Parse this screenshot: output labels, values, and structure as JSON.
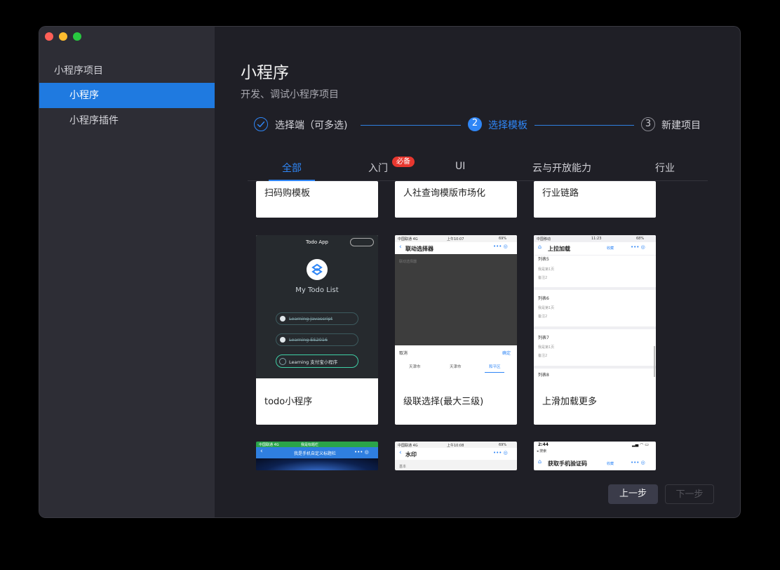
{
  "sidebar": {
    "section_title": "小程序项目",
    "items": [
      {
        "label": "小程序",
        "active": true
      },
      {
        "label": "小程序插件",
        "active": false
      }
    ]
  },
  "main": {
    "title": "小程序",
    "subtitle": "开发、调试小程序项目"
  },
  "steps": [
    {
      "number": "1",
      "label": "选择端（可多选)",
      "state": "done"
    },
    {
      "number": "2",
      "label": "选择模板",
      "state": "current"
    },
    {
      "number": "3",
      "label": "新建项目",
      "state": "pending"
    }
  ],
  "tabs": [
    {
      "label": "全部",
      "active": true
    },
    {
      "label": "入门",
      "badge": "必备"
    },
    {
      "label": "UI"
    },
    {
      "label": "云与开放能力"
    },
    {
      "label": "行业"
    }
  ],
  "cards_row1": [
    "扫码购模板",
    "人社查询模版市场化",
    "行业链路"
  ],
  "cards_row2": [
    {
      "title": "todo小程序",
      "thumb": {
        "header": "Todo App",
        "heading": "My Todo List",
        "items": [
          "Learning Javascript",
          "Learning ES2016",
          "Learning 支付宝小程序"
        ]
      }
    },
    {
      "title": "级联选择(最大三级)",
      "thumb": {
        "status_left": "中国联通 4G",
        "status_time": "上午10:07",
        "status_right": "69%",
        "nav_title": "联动选择器",
        "section": "联动选择器",
        "cancel": "取消",
        "confirm": "确定",
        "options": [
          "天津市",
          "天津市",
          "和平区"
        ]
      }
    },
    {
      "title": "上滑加载更多",
      "thumb": {
        "status_left": "中国移动",
        "status_time": "11:23",
        "status_right": "68%",
        "nav_title": "上拉加载",
        "fav": "收藏",
        "lists": [
          {
            "name": "列表5",
            "line1": "我是第1页",
            "line2": "备注2"
          },
          {
            "name": "列表6",
            "line1": "我是第1页",
            "line2": "备注2"
          },
          {
            "name": "列表7",
            "line1": "我是第1页",
            "line2": "备注2"
          },
          {
            "name": "列表8"
          }
        ]
      }
    }
  ],
  "cards_row3": [
    {
      "status_left": "中国联通 4G",
      "status_time": "我是标题栏",
      "nav_title": "我是手机自定义标题栏"
    },
    {
      "status_left": "中国联通 4G",
      "status_time": "上午10:08",
      "status_right": "69%",
      "nav_title": "水印",
      "section": "基本"
    },
    {
      "status_left": "2:44",
      "status_right": "",
      "back": "◂ 搜索",
      "nav_title": "获取手机验证码",
      "fav": "收藏"
    }
  ],
  "buttons": {
    "prev": "上一步",
    "next": "下一步"
  },
  "colors": {
    "accent": "#2f86f6",
    "sidebar_bg": "#2d2d35",
    "main_bg": "#1f1f26",
    "badge": "#e7372f"
  }
}
